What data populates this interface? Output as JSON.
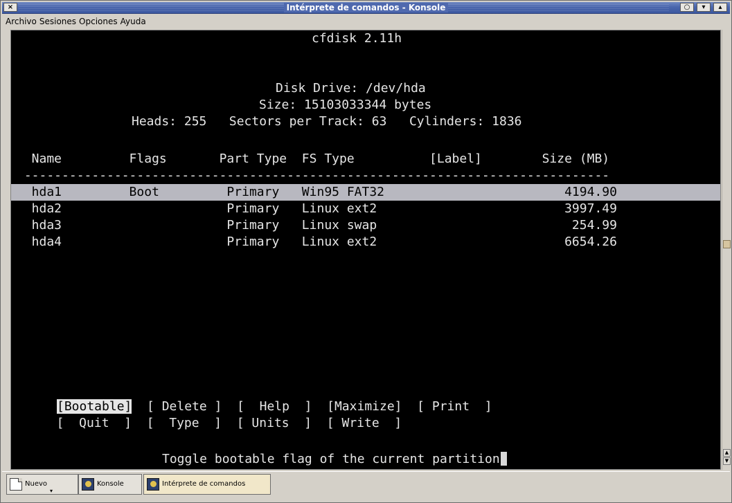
{
  "window": {
    "title": "Intérprete de comandos - Konsole",
    "close_glyph": "×",
    "button_glyphs": [
      "○",
      "▾",
      "▴"
    ]
  },
  "menu": [
    "Archivo",
    "Sesiones",
    "Opciones",
    "Ayuda"
  ],
  "terminal": {
    "program_title": "cfdisk 2.11h",
    "disk_drive": "Disk Drive: /dev/hda",
    "size_line": "Size: 15103033344 bytes",
    "geometry_line": "Heads: 255   Sectors per Track: 63   Cylinders: 1836",
    "columns": [
      "Name",
      "Flags",
      "Part Type",
      "FS Type",
      "[Label]",
      "Size (MB)"
    ],
    "header_line": "  Name         Flags       Part Type  FS Type          [Label]        Size (MB)",
    "separator": " ------------------------------------------------------------------------------",
    "partitions": [
      {
        "name": "hda1",
        "flags": "Boot",
        "part_type": "Primary",
        "fs_type": "Win95 FAT32",
        "label": "",
        "size_mb": "4194.90",
        "line": "  hda1         Boot         Primary   Win95 FAT32                        4194.90"
      },
      {
        "name": "hda2",
        "flags": "",
        "part_type": "Primary",
        "fs_type": "Linux ext2",
        "label": "",
        "size_mb": "3997.49",
        "line": "  hda2                      Primary   Linux ext2                         3997.49"
      },
      {
        "name": "hda3",
        "flags": "",
        "part_type": "Primary",
        "fs_type": "Linux swap",
        "label": "",
        "size_mb": "254.99",
        "line": "  hda3                      Primary   Linux swap                          254.99"
      },
      {
        "name": "hda4",
        "flags": "",
        "part_type": "Primary",
        "fs_type": "Linux ext2",
        "label": "",
        "size_mb": "6654.26",
        "line": "  hda4                      Primary   Linux ext2                         6654.26"
      }
    ],
    "selected_partition": "hda1",
    "commands_row1": {
      "selected": "[Bootable]",
      "rest": "  [ Delete ]  [  Help  ]  [Maximize]  [ Print  ]"
    },
    "commands_row2": "  [  Quit  ]  [  Type  ]  [ Units  ]  [ Write  ]",
    "commands": [
      "Bootable",
      "Delete",
      "Help",
      "Maximize",
      "Print",
      "Quit",
      "Type",
      "Units",
      "Write"
    ],
    "status": "Toggle bootable flag of the current partition"
  },
  "taskbar": {
    "items": [
      "Nuevo",
      "Konsole",
      "Intérprete de comandos"
    ],
    "active": "Intérprete de comandos"
  },
  "colors": {
    "titlebar": "#4a66ad",
    "terminal_bg": "#000000",
    "terminal_fg": "#e6e6e6",
    "selection_bg": "#b8b8c0"
  }
}
